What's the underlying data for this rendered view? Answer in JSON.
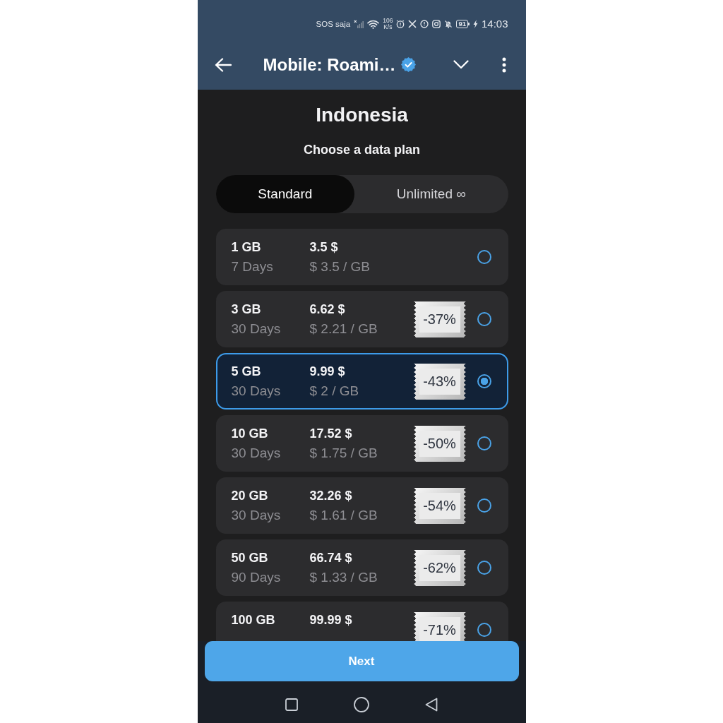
{
  "status_bar": {
    "carrier": "SOS saja",
    "speed_value": "106",
    "speed_unit": "K/s",
    "battery": "91",
    "time": "14:03"
  },
  "header": {
    "title": "Mobile: Roami…",
    "verified": true
  },
  "intro": {
    "country": "Indonesia",
    "subtitle": "Choose a data plan"
  },
  "plan_types": [
    {
      "label": "Standard",
      "selected": true
    },
    {
      "label": "Unlimited ∞",
      "selected": false
    }
  ],
  "plans": [
    {
      "data": "1 GB",
      "duration": "7 Days",
      "price": "3.5 $",
      "unit_price": "$ 3.5 / GB",
      "selected": false
    },
    {
      "data": "3 GB",
      "duration": "30 Days",
      "price": "6.62 $",
      "unit_price": "$ 2.21 / GB",
      "discount": "-37%",
      "selected": false
    },
    {
      "data": "5 GB",
      "duration": "30 Days",
      "price": "9.99 $",
      "unit_price": "$ 2 / GB",
      "discount": "-43%",
      "selected": true
    },
    {
      "data": "10 GB",
      "duration": "30 Days",
      "price": "17.52 $",
      "unit_price": "$ 1.75 / GB",
      "discount": "-50%",
      "selected": false
    },
    {
      "data": "20 GB",
      "duration": "30 Days",
      "price": "32.26 $",
      "unit_price": "$ 1.61 / GB",
      "discount": "-54%",
      "selected": false
    },
    {
      "data": "50 GB",
      "duration": "90 Days",
      "price": "66.74 $",
      "unit_price": "$ 1.33 / GB",
      "discount": "-62%",
      "selected": false
    },
    {
      "data": "100 GB",
      "price": "99.99 $",
      "discount": "-71%",
      "selected": false
    }
  ],
  "next_button": {
    "label": "Next"
  }
}
